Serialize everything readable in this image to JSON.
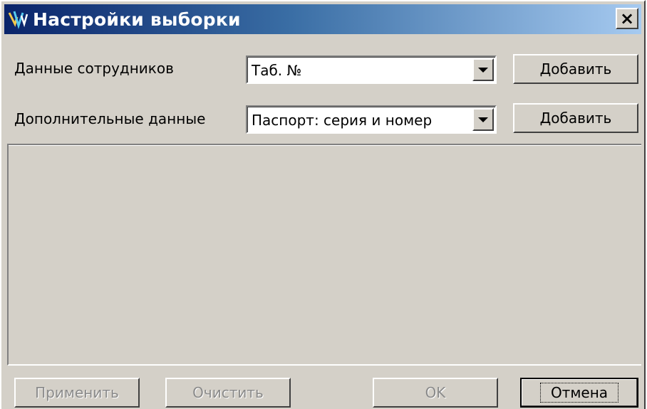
{
  "window": {
    "title": "Настройки выборки",
    "close_label": "×"
  },
  "rows": [
    {
      "label": "Данные сотрудников",
      "combo_value": "Таб. №",
      "add_label": "Добавить"
    },
    {
      "label": "Дополнительные данные",
      "combo_value": "Паспорт: серия и номер",
      "add_label": "Добавить"
    }
  ],
  "footer": {
    "apply_label": "Применить",
    "clear_label": "Очистить",
    "ok_label": "OK",
    "cancel_label": "Отмена"
  },
  "icons": {
    "app": "app-logo-icon",
    "close": "close-icon",
    "dropdown": "chevron-down-icon"
  },
  "colors": {
    "face": "#d4d0c8",
    "title_start": "#0a246a",
    "title_end": "#a6caf0",
    "disabled_text": "#8a8a8a"
  }
}
